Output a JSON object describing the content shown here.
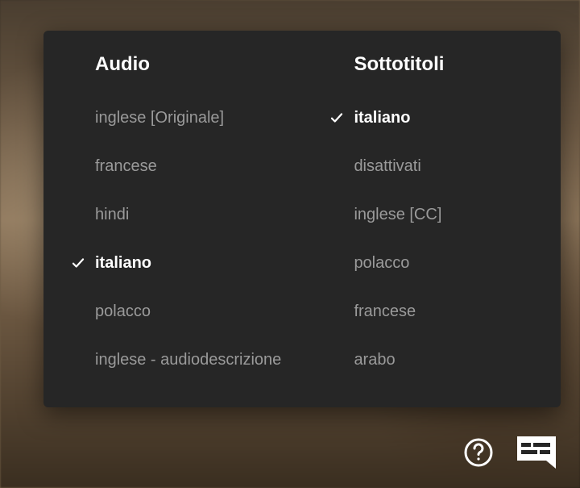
{
  "panel": {
    "audio": {
      "title": "Audio",
      "selectedIndex": 3,
      "options": [
        {
          "label": "inglese [Originale]"
        },
        {
          "label": "francese"
        },
        {
          "label": "hindi"
        },
        {
          "label": "italiano"
        },
        {
          "label": "polacco"
        },
        {
          "label": "inglese - audiodescrizione"
        }
      ]
    },
    "subtitles": {
      "title": "Sottotitoli",
      "selectedIndex": 0,
      "options": [
        {
          "label": "italiano"
        },
        {
          "label": "disattivati"
        },
        {
          "label": "inglese [CC]"
        },
        {
          "label": "polacco"
        },
        {
          "label": "francese"
        },
        {
          "label": "arabo"
        }
      ]
    }
  },
  "icons": {
    "help": "help-icon",
    "subtitles": "subtitles-icon"
  }
}
